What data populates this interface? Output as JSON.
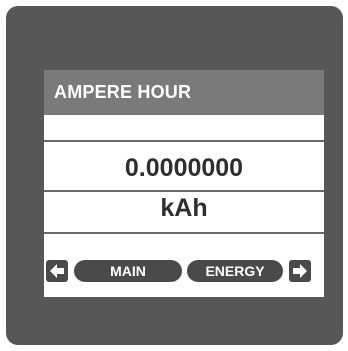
{
  "screen": {
    "title": "AMPERE HOUR",
    "value": "0.0000000",
    "unit": "kAh"
  },
  "nav": {
    "left_icon": "arrow-left-icon",
    "main_label": "MAIN",
    "energy_label": "ENERGY",
    "right_icon": "arrow-right-icon"
  },
  "colors": {
    "bezel": "#575757",
    "title_bar": "#7a7a7a",
    "text_dark": "#2f2f2f",
    "button": "#4a4a4a"
  }
}
